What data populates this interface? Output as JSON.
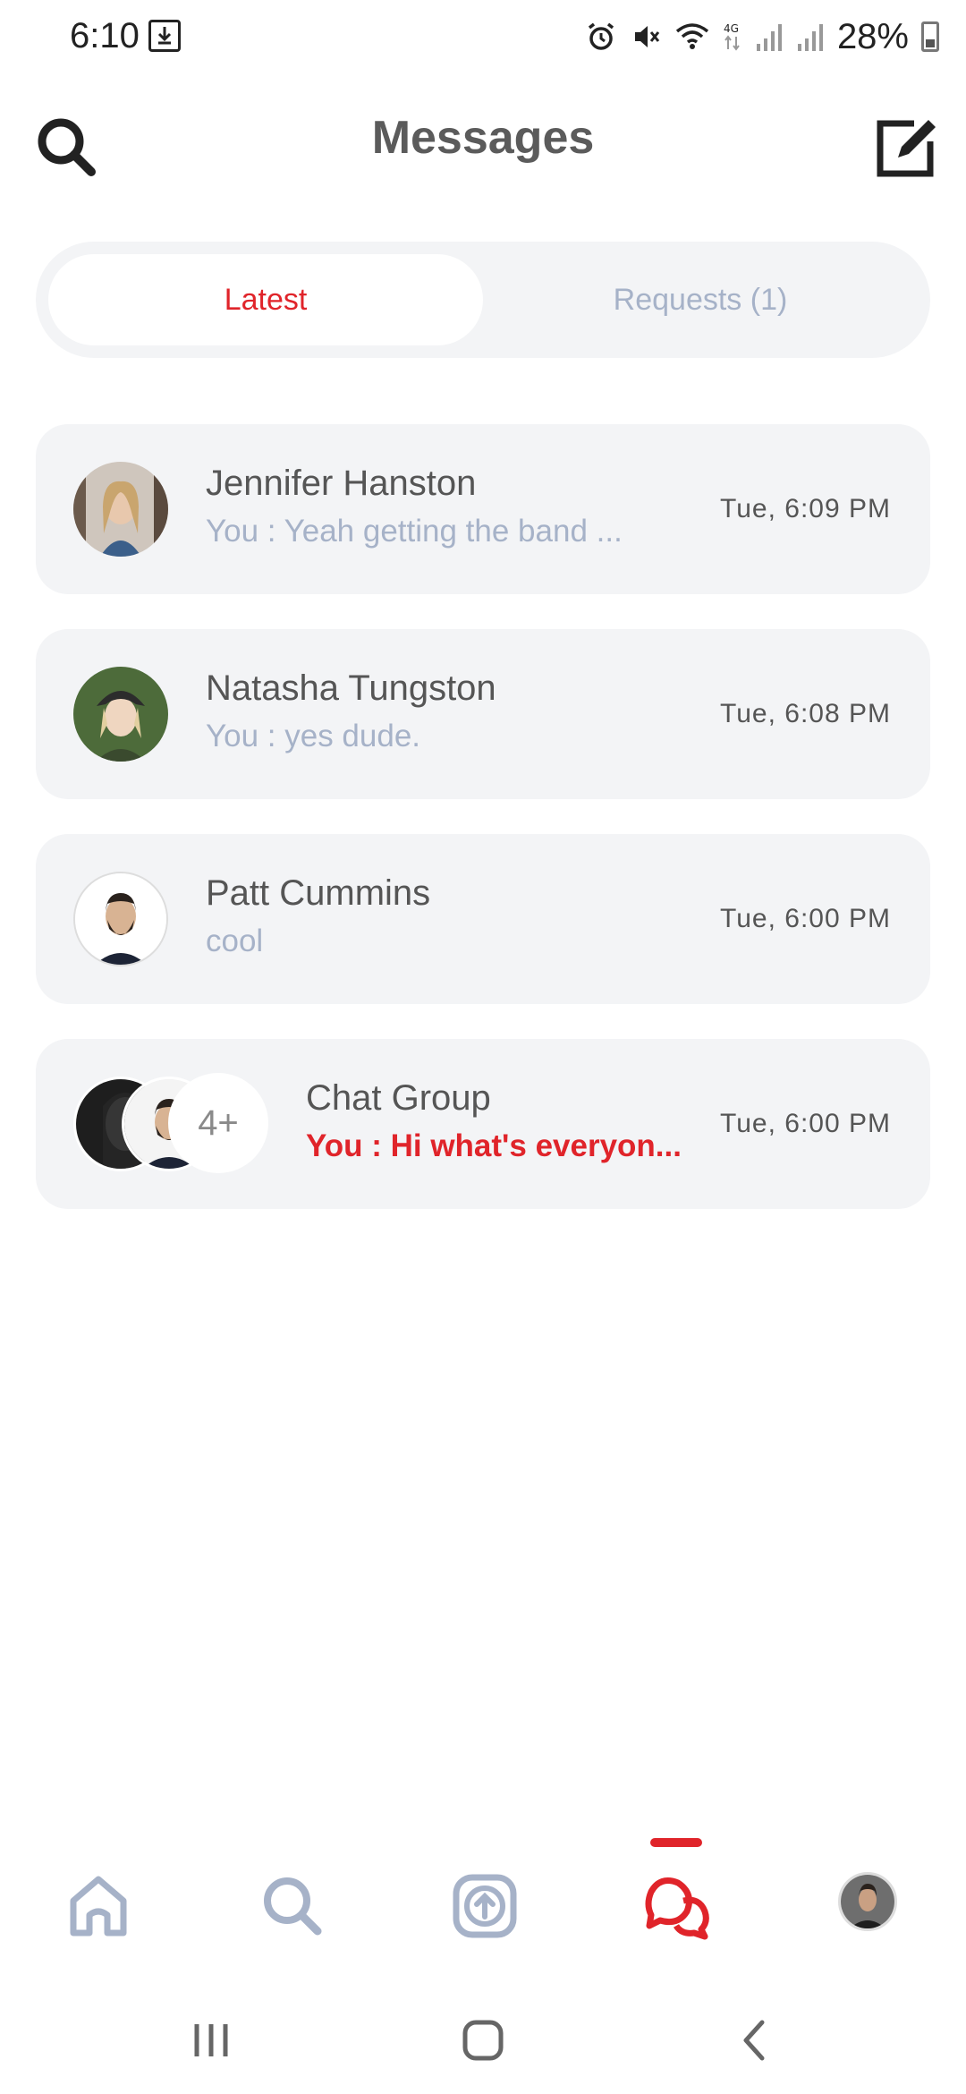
{
  "status_bar": {
    "time": "6:10",
    "battery": "28%"
  },
  "header": {
    "title": "Messages"
  },
  "tabs": [
    {
      "label": "Latest",
      "active": true
    },
    {
      "label": "Requests (1)",
      "active": false
    }
  ],
  "conversations": [
    {
      "name": "Jennifer Hanston",
      "preview": "You : Yeah getting the band ...",
      "time": "Tue, 6:09 PM",
      "unread": false
    },
    {
      "name": "Natasha Tungston",
      "preview": "You : yes dude.",
      "time": "Tue, 6:08 PM",
      "unread": false
    },
    {
      "name": "Patt Cummins",
      "preview": "cool",
      "time": "Tue, 6:00 PM",
      "unread": false
    },
    {
      "name": "Chat Group",
      "preview": "You : Hi what's everyon...",
      "time": "Tue, 6:00 PM",
      "unread": true,
      "more_members": "4+"
    }
  ],
  "bottom_nav": {
    "items": [
      "home-icon",
      "search-icon",
      "upload-icon",
      "messages-icon",
      "profile-avatar"
    ],
    "active": "messages-icon"
  },
  "colors": {
    "accent": "#e0242a",
    "muted": "#a6b2c8",
    "card": "#f3f4f6",
    "icon_inactive": "#a6b2c8"
  }
}
